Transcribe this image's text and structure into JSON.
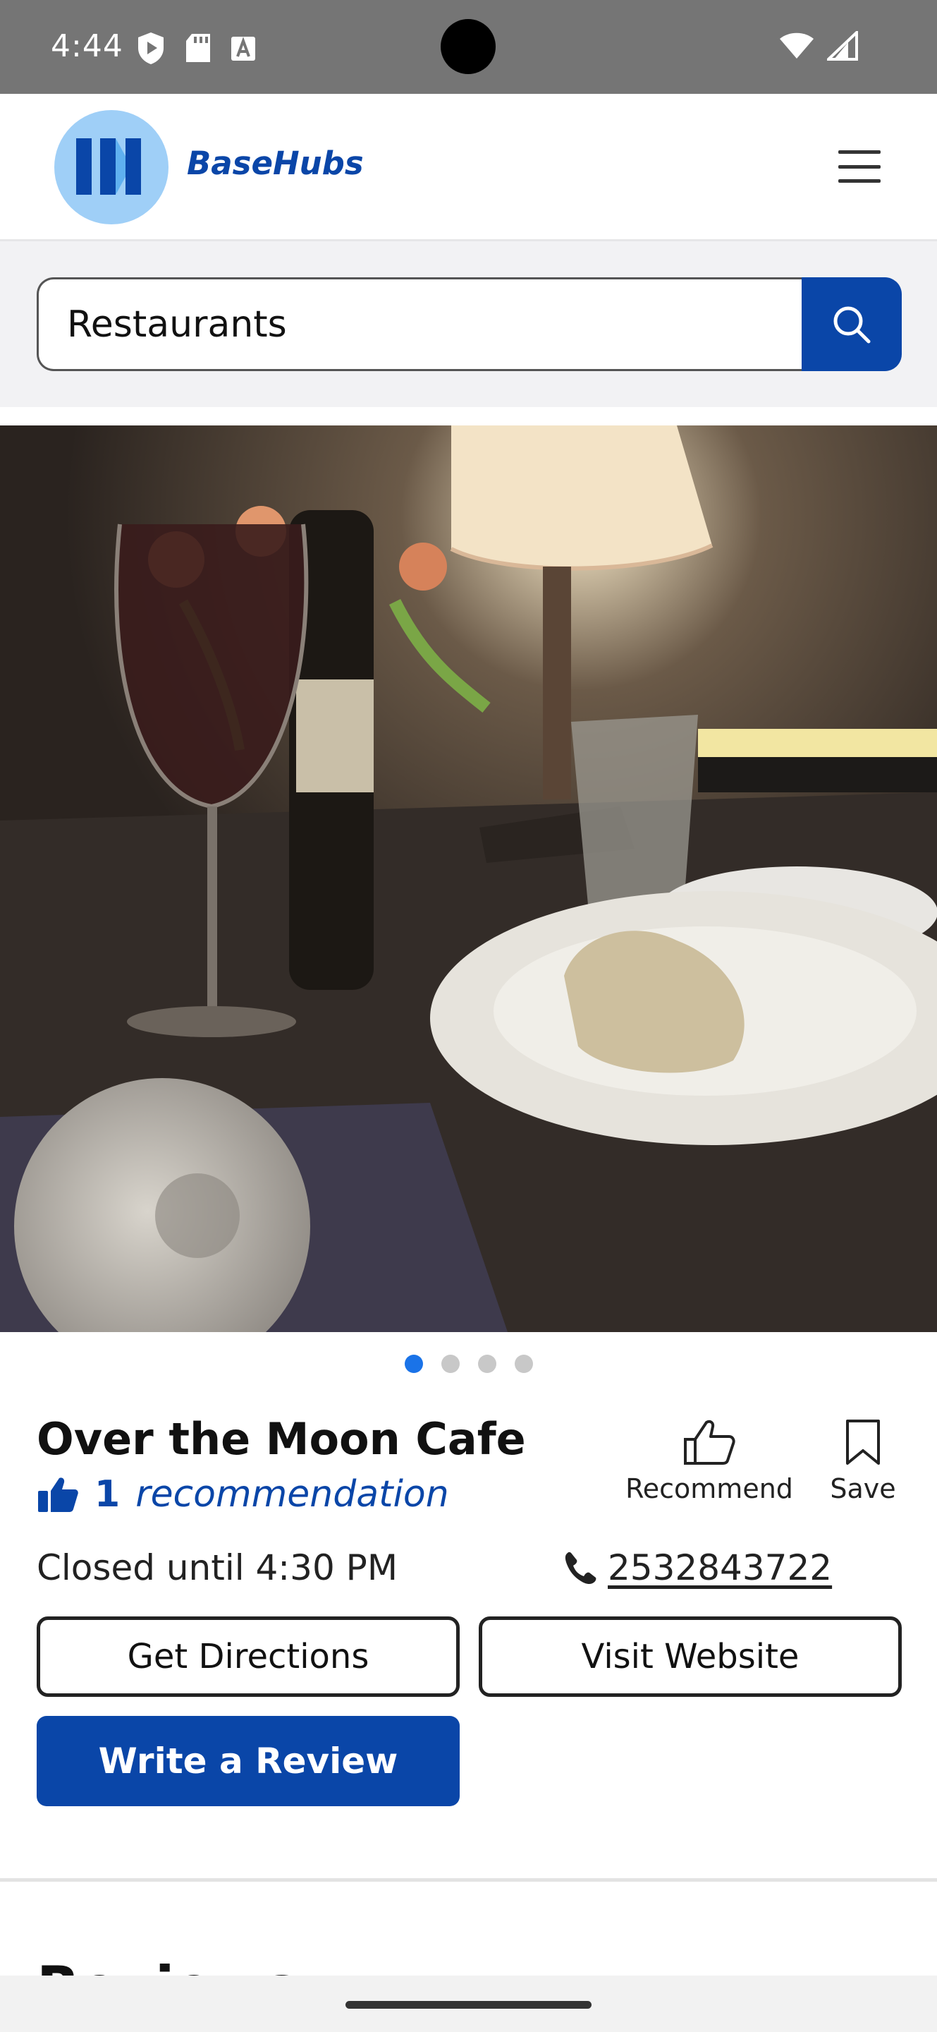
{
  "status_bar": {
    "time": "4:44",
    "icons_left": [
      "shield-play-icon",
      "sd-card-icon",
      "font-a-icon"
    ],
    "icons_right": [
      "wifi-icon",
      "cell-signal-icon"
    ]
  },
  "header": {
    "brand": "BaseHubs",
    "logo_color": "#9fcff7",
    "brand_color": "#0a46a8",
    "menu_icon": "hamburger-menu-icon"
  },
  "search": {
    "value": "Restaurants",
    "button_icon": "search-icon"
  },
  "carousel": {
    "image_alt": "Dinner table with wine glass, flowers, lamp, water glass and bread on plate",
    "slide_count": 4,
    "active_index": 0
  },
  "business": {
    "name": "Over the Moon Cafe",
    "recommendation_count": "1",
    "recommendation_label": "recommendation",
    "hours": "Closed until 4:30 PM",
    "phone": "2532843722"
  },
  "actions": {
    "recommend_label": "Recommend",
    "save_label": "Save",
    "directions_label": "Get Directions",
    "website_label": "Visit Website",
    "review_label": "Write a Review"
  },
  "next_section": {
    "heading": "Reviews"
  },
  "colors": {
    "accent": "#0a46a8",
    "dot_active": "#1a73e8",
    "dot_inactive": "#c8c8c8"
  }
}
